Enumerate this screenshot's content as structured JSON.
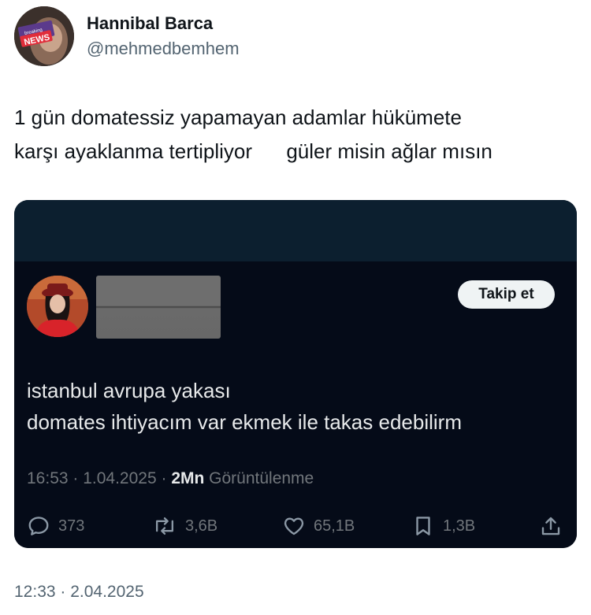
{
  "author": {
    "name": "Hannibal Barca",
    "handle": "@mehmedbemhem",
    "avatar_badge": "NEWS",
    "avatar_badge_small": "breaking"
  },
  "tweet": {
    "line1": "1 gün domatessiz yapamayan adamlar hükümete",
    "line2": "karşı ayaklanma tertipliyor      güler misin ağlar mısın",
    "timestamp": "12:33 · 2.04.2025"
  },
  "quoted": {
    "follow_label": "Takip et",
    "text_line1": "istanbul avrupa yakası",
    "text_line2": "domates ihtiyacım var ekmek ile takas edebilirm",
    "time": "16:53 · 1.04.2025 · ",
    "views_count": "2Mn",
    "views_label": " Görüntülenme",
    "stats": {
      "replies": "373",
      "reposts": "3,6B",
      "likes": "65,1B",
      "bookmarks": "1,3B"
    },
    "colors": {
      "card_background": "#050b18",
      "text": "#e7e9ea",
      "muted": "#71767b"
    }
  }
}
